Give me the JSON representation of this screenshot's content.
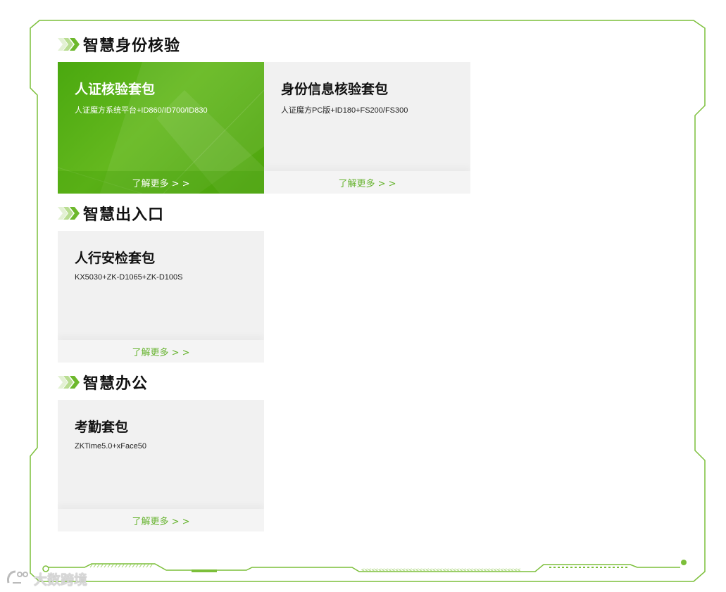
{
  "colors": {
    "accent": "#7cbf3a",
    "card_bg": "#f1f1f1",
    "green_card": "#5cb31a",
    "link": "#66b32e"
  },
  "sections": [
    {
      "title": "智慧身份核验",
      "cards": [
        {
          "title": "人证核验套包",
          "subtitle": "人证魔方系统平台+ID860/ID700/ID830",
          "link": "了解更多 > >",
          "highlighted": true
        },
        {
          "title": "身份信息核验套包",
          "subtitle": "人证魔方PC版+ID180+FS200/FS300",
          "link": "了解更多 > >",
          "highlighted": false
        }
      ]
    },
    {
      "title": "智慧出入口",
      "cards": [
        {
          "title": "人行安检套包",
          "subtitle": "KX5030+ZK-D1065+ZK-D100S",
          "link": "了解更多 > >",
          "highlighted": false
        }
      ]
    },
    {
      "title": "智慧办公",
      "cards": [
        {
          "title": "考勤套包",
          "subtitle": "ZKTime5.0+xFace50",
          "link": "了解更多 > >",
          "highlighted": false
        }
      ]
    }
  ],
  "watermark": {
    "text": "大数跨境"
  },
  "icons": {
    "section_marker": "chevron-arrows-icon",
    "watermark_logo": "brand-logo-icon"
  }
}
